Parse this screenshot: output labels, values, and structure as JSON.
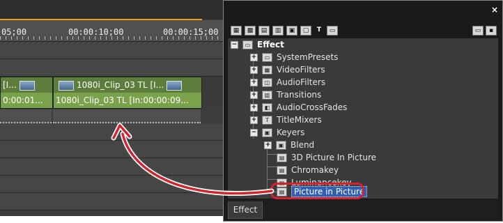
{
  "timeline": {
    "timecodes": [
      "05;00",
      "00:00:10;00",
      "00:00:15;00"
    ],
    "clip_left": {
      "top_label": "[I...",
      "bottom_label": "0:00:01..."
    },
    "clip_right": {
      "top_label": "1080i_Clip_03  TL [I...",
      "bottom_label": "1080i_Clip_03  TL [In:00:00:09..."
    }
  },
  "panel": {
    "close_label": "×",
    "toolbar_icons": [
      "grid-icon",
      "grid2-icon",
      "list-icon",
      "list2-icon",
      "box-icon",
      "box2-icon",
      "title-t-icon",
      "monitor-icon"
    ],
    "tree": {
      "root": "Effect",
      "items": [
        {
          "label": "SystemPresets",
          "expander": "+",
          "icon": "folder-icon"
        },
        {
          "label": "VideoFilters",
          "expander": "+",
          "icon": "video-filter-icon"
        },
        {
          "label": "AudioFilters",
          "expander": "+",
          "icon": "audio-filter-icon"
        },
        {
          "label": "Transitions",
          "expander": "+",
          "icon": "transition-icon"
        },
        {
          "label": "AudioCrossFades",
          "expander": "+",
          "icon": "audio-crossfade-icon"
        },
        {
          "label": "TitleMixers",
          "expander": "+",
          "icon": "title-mixer-icon"
        },
        {
          "label": "Keyers",
          "expander": "−",
          "icon": "keyer-icon"
        }
      ],
      "keyers_children": [
        {
          "label": "Blend",
          "expander": "+"
        },
        {
          "label": "3D Picture In Picture"
        },
        {
          "label": "Chromakey"
        },
        {
          "label": "Luminancekey"
        },
        {
          "label": "Picture in Picture",
          "selected": true
        }
      ]
    },
    "tab_label": "Effect"
  },
  "colors": {
    "callout": "#d3232e",
    "selection": "#2f5fb6",
    "clip_green": "#7aa24a"
  }
}
